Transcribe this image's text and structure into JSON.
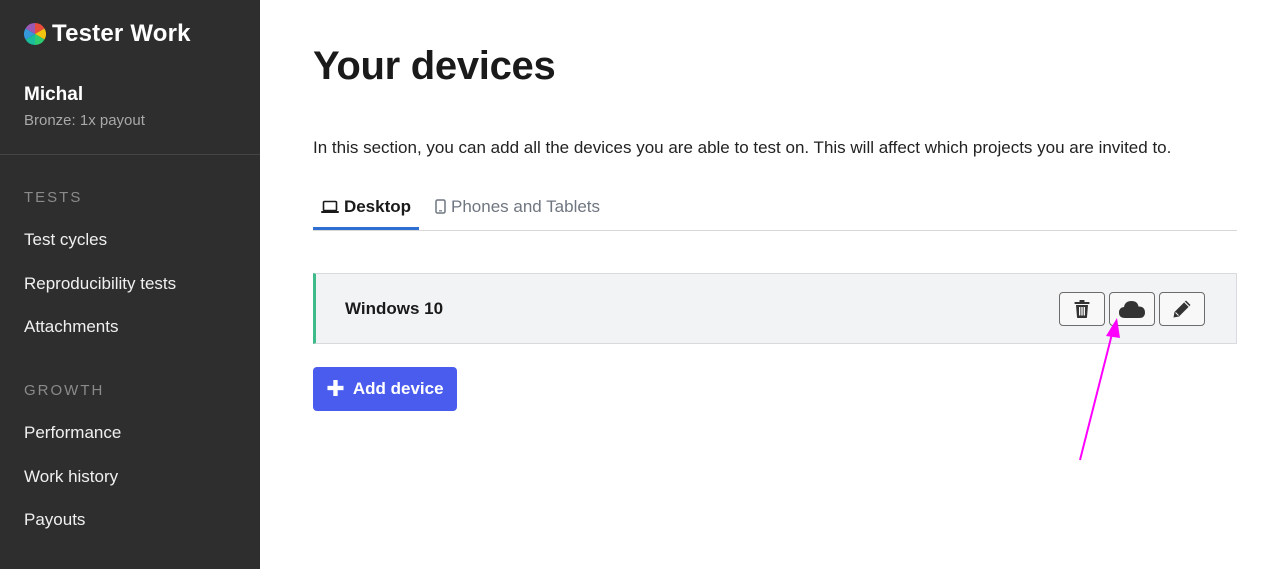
{
  "sidebar": {
    "brand": {
      "name": "Tester Work",
      "logo_icon": "color-wheel-logo"
    },
    "user": {
      "name": "Michal",
      "tier": "Bronze: 1x payout"
    },
    "sections": [
      {
        "label": "TESTS",
        "items": [
          "Test cycles",
          "Reproducibility tests",
          "Attachments"
        ]
      },
      {
        "label": "GROWTH",
        "items": [
          "Performance",
          "Work history",
          "Payouts"
        ]
      }
    ]
  },
  "main": {
    "title": "Your devices",
    "intro": "In this section, you can add all the devices you are able to test on. This will affect which projects you are invited to.",
    "tabs": [
      {
        "label": "Desktop",
        "icon": "laptop-icon",
        "active": true
      },
      {
        "label": "Phones and Tablets",
        "icon": "phone-icon",
        "active": false
      }
    ],
    "devices": [
      {
        "name": "Windows 10",
        "actions": [
          "trash-icon",
          "cloud-icon",
          "pencil-icon"
        ]
      }
    ],
    "add_button": "Add device"
  },
  "colors": {
    "sidebar_bg": "#2e2e2e",
    "accent_blue": "#4a5ced",
    "tab_underline": "#2f6fd1",
    "device_border": "#3dbb8a",
    "annotation": "#ff00ff"
  }
}
